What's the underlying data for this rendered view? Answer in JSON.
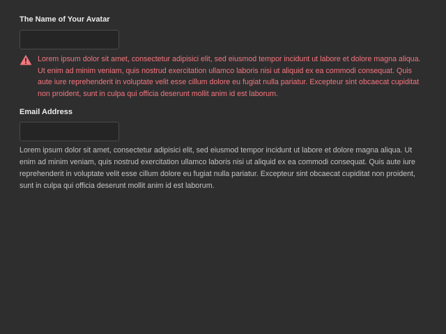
{
  "fields": {
    "avatar_name": {
      "label": "The Name of Your Avatar",
      "value": "",
      "placeholder": "",
      "error_text": "Lorem ipsum dolor sit amet, consectetur adipisici elit, sed eiusmod tempor incidunt ut labore et dolore magna aliqua. Ut enim ad minim veniam, quis nostrud exercitation ullamco laboris nisi ut aliquid ex ea commodi consequat. Quis aute iure reprehenderit in voluptate velit esse cillum dolore eu fugiat nulla pariatur. Excepteur sint obcaecat cupiditat non proident, sunt in culpa qui officia deserunt mollit anim id est laborum.",
      "error_icon": "warning-triangle-icon"
    },
    "email": {
      "label": "Email Address",
      "value": "",
      "placeholder": "",
      "help_text": "Lorem ipsum dolor sit amet, consectetur adipisici elit, sed eiusmod tempor incidunt ut labore et dolore magna aliqua. Ut enim ad minim veniam, quis nostrud exercitation ullamco laboris nisi ut aliquid ex ea commodi consequat. Quis aute iure reprehenderit in voluptate velit esse cillum dolore eu fugiat nulla pariatur. Excepteur sint obcaecat cupiditat non proident, sunt in culpa qui officia deserunt mollit anim id est laborum."
    }
  },
  "colors": {
    "background": "#2e2e2f",
    "error": "#f5767d",
    "input_background": "#252525",
    "input_border": "#4b4b4b",
    "label": "#ececec",
    "help_text": "#c4c4c4"
  }
}
